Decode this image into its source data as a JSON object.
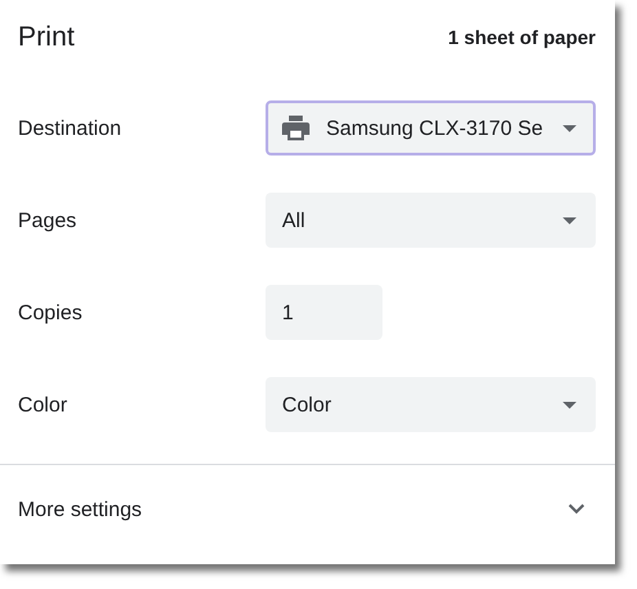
{
  "header": {
    "title": "Print",
    "summary": "1 sheet of paper"
  },
  "settings": [
    {
      "label": "Destination",
      "kind": "device_select",
      "value": "Samsung CLX-3170 Se",
      "focused": true
    },
    {
      "label": "Pages",
      "kind": "select",
      "value": "All",
      "focused": false
    },
    {
      "label": "Copies",
      "kind": "input",
      "value": "1",
      "focused": false
    },
    {
      "label": "Color",
      "kind": "select",
      "value": "Color",
      "focused": false
    }
  ],
  "more_settings": {
    "label": "More settings",
    "expanded": false
  }
}
